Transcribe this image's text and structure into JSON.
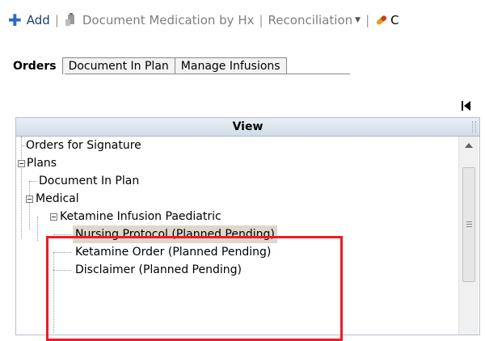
{
  "toolbar": {
    "add_label": "Add",
    "document_medication_label": "Document Medication by Hx",
    "reconciliation_label": "Reconciliation",
    "trailing_label": "C"
  },
  "tabs": [
    {
      "label": "Orders",
      "active": true
    },
    {
      "label": "Document In Plan",
      "active": false
    },
    {
      "label": "Manage Infusions",
      "active": false
    }
  ],
  "panel": {
    "header": "View"
  },
  "tree": {
    "orders_for_signature": "Orders for Signature",
    "plans": "Plans",
    "document_in_plan": "Document In Plan",
    "medical": "Medical",
    "ketamine_infusion": "Ketamine Infusion Paediatric",
    "nursing_protocol": "Nursing Protocol (Planned Pending)",
    "ketamine_order": "Ketamine Order (Planned Pending)",
    "disclaimer": "Disclaimer (Planned Pending)"
  },
  "icons": {
    "add": "plus-icon",
    "document_medication": "document-medication-icon",
    "reconciliation": "dropdown-chevron-icon",
    "trailing": "pill-icon",
    "collapse": "collapse-panel-icon"
  },
  "colors": {
    "highlight": "#ee1c25",
    "selected_row": "#ded7cc",
    "add_icon": "#2e6bc6"
  }
}
